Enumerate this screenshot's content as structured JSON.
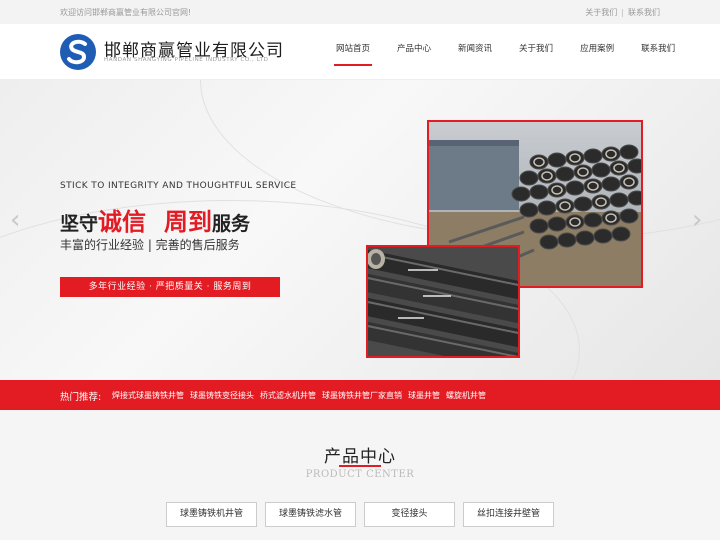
{
  "topbar": {
    "welcome": "欢迎访问邯郸商赢管业有限公司官网!",
    "links": [
      "关于我们",
      "联系我们"
    ]
  },
  "header": {
    "logo_letter": "S",
    "company_cn": "邯郸商赢管业有限公司",
    "company_en": "HANDAN SHANGYING PIPELINE INDUSTRY CO., LTD",
    "nav": [
      "网站首页",
      "产品中心",
      "新闻资讯",
      "关于我们",
      "应用案例",
      "联系我们"
    ],
    "active_nav": "网站首页"
  },
  "banner": {
    "slogan_en": "STICK TO INTEGRITY AND THOUGHTFUL SERVICE",
    "slogan_part1": "坚守",
    "slogan_red1": "诚信",
    "slogan_red2": "周到",
    "slogan_part2": "服务",
    "slogan_sub": "丰富的行业经验 | 完善的售后服务",
    "slogan_bar": "多年行业经验 · 严把质量关 · 服务周到",
    "prev_arrow": "‹",
    "next_arrow": "›"
  },
  "hot": {
    "label": "热门推荐:",
    "links": [
      "焊接式球墨铸铁井管",
      "球墨铸铁变径接头",
      "桥式滤水机井管",
      "球墨铸铁井管厂家直销",
      "球墨井管",
      "螺旋机井管"
    ]
  },
  "product_center": {
    "title": "产品中心",
    "subtitle": "PRODUCT CENTER",
    "categories": [
      "球墨铸铁机井管",
      "球墨铸铁滤水管",
      "变径接头",
      "丝扣连接井壁管"
    ]
  },
  "colors": {
    "accent": "#e31b23",
    "logo_blue": "#1f5db5"
  }
}
